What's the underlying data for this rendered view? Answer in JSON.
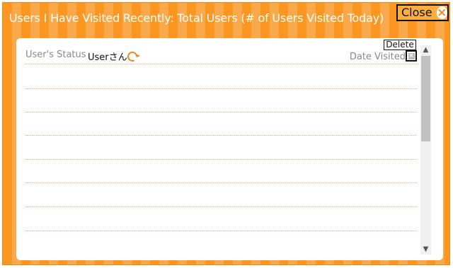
{
  "dialog": {
    "title": "Users I Have Visited Recently: Total Users (# of Users Visited Today)",
    "close_label": "Close"
  },
  "list": {
    "status_header": "User's Status",
    "user_name": "Userさん",
    "date_header": "Date Visited",
    "delete_tooltip": "Delete",
    "empty_rows": 7
  },
  "icons": {
    "close": "close-icon",
    "refresh": "refresh-icon",
    "delete": "delete-icon"
  },
  "colors": {
    "accent_orange": "#fb9620",
    "stripe_light": "#f9a84a",
    "row_divider": "#f3a766"
  }
}
